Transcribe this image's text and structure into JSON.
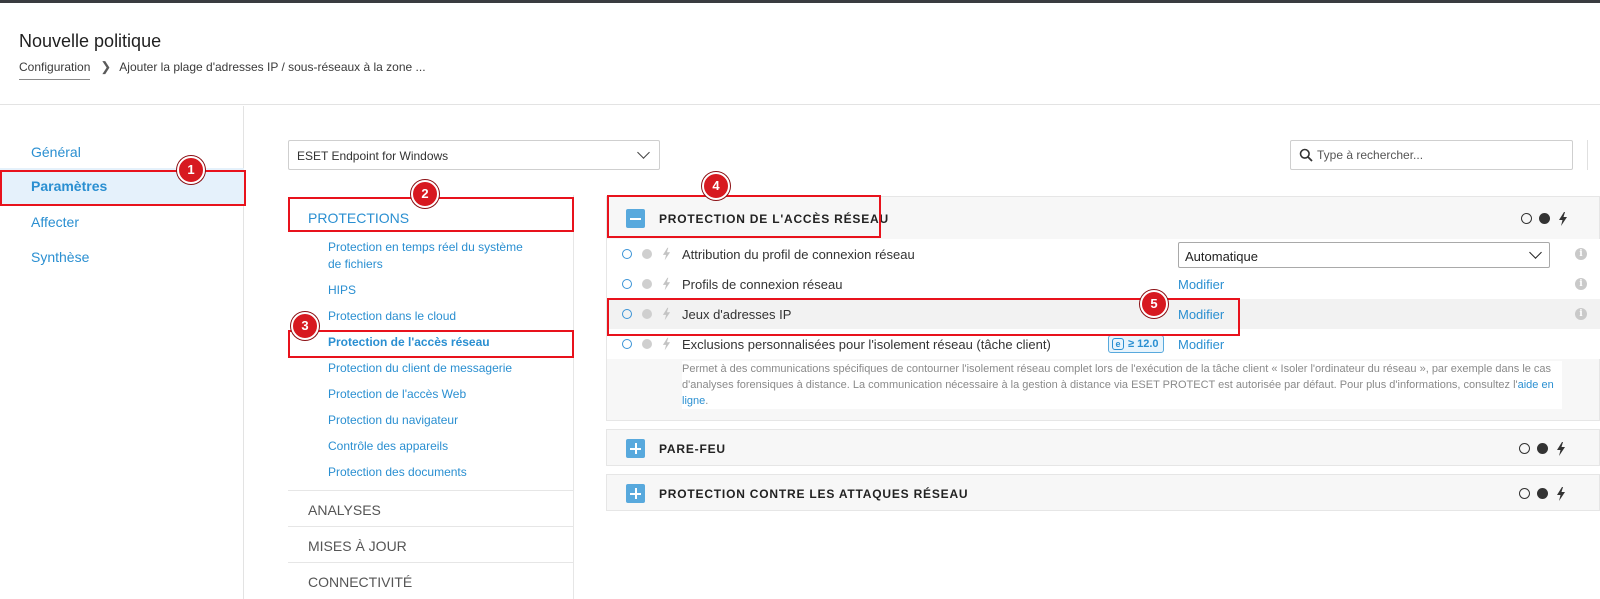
{
  "header": {
    "title": "Nouvelle politique",
    "breadcrumb": {
      "link": "Configuration",
      "current": "Ajouter la plage d'adresses IP / sous-réseaux à la zone ..."
    }
  },
  "left_nav": {
    "items": [
      {
        "label": "Général"
      },
      {
        "label": "Paramètres",
        "active": true
      },
      {
        "label": "Affecter"
      },
      {
        "label": "Synthèse"
      }
    ]
  },
  "product_select": {
    "value": "ESET Endpoint for Windows"
  },
  "search": {
    "placeholder": "Type à rechercher..."
  },
  "categories": {
    "protections": {
      "label": "PROTECTIONS",
      "items": [
        {
          "label": "Protection en temps réel du système de fichiers"
        },
        {
          "label": "HIPS"
        },
        {
          "label": "Protection dans le cloud"
        },
        {
          "label": "Protection de l'accès réseau",
          "active": true
        },
        {
          "label": "Protection du client de messagerie"
        },
        {
          "label": "Protection de l'accès Web"
        },
        {
          "label": "Protection du navigateur"
        },
        {
          "label": "Contrôle des appareils"
        },
        {
          "label": "Protection des documents"
        }
      ]
    },
    "others": [
      {
        "label": "ANALYSES"
      },
      {
        "label": "MISES À JOUR"
      },
      {
        "label": "CONNECTIVITÉ"
      }
    ]
  },
  "sections": {
    "network_access": {
      "title": "PROTECTION DE L'ACCÈS RÉSEAU",
      "rows": {
        "profile_assign": {
          "label": "Attribution du profil de connexion réseau",
          "value": "Automatique"
        },
        "profiles": {
          "label": "Profils de connexion réseau",
          "link": "Modifier"
        },
        "ip_sets": {
          "label": "Jeux d'adresses IP",
          "link": "Modifier"
        },
        "exclusions": {
          "label": "Exclusions personnalisées pour l'isolement réseau (tâche client)",
          "badge_icon": "e",
          "badge": "≥ 12.0",
          "link": "Modifier"
        }
      },
      "description": "Permet à des communications spécifiques de contourner l'isolement réseau complet lors de l'exécution de la tâche client « Isoler l'ordinateur du réseau », par exemple dans le cas d'analyses forensiques à distance. La communication nécessaire à la gestion à distance via ESET PROTECT est autorisée par défaut. Pour plus d'informations, consultez l'",
      "description_link": "aide en ligne",
      "description_end": "."
    },
    "firewall": {
      "title": "PARE-FEU"
    },
    "attacks": {
      "title": "PROTECTION CONTRE LES ATTAQUES RÉSEAU"
    }
  },
  "annotations": [
    "1",
    "2",
    "3",
    "4",
    "5"
  ],
  "colors": {
    "accent": "#2a8fd1",
    "active_nav_bg": "#e5f1fb",
    "annotation_red": "#e8121c",
    "toggle_blue": "#58a9dd"
  }
}
